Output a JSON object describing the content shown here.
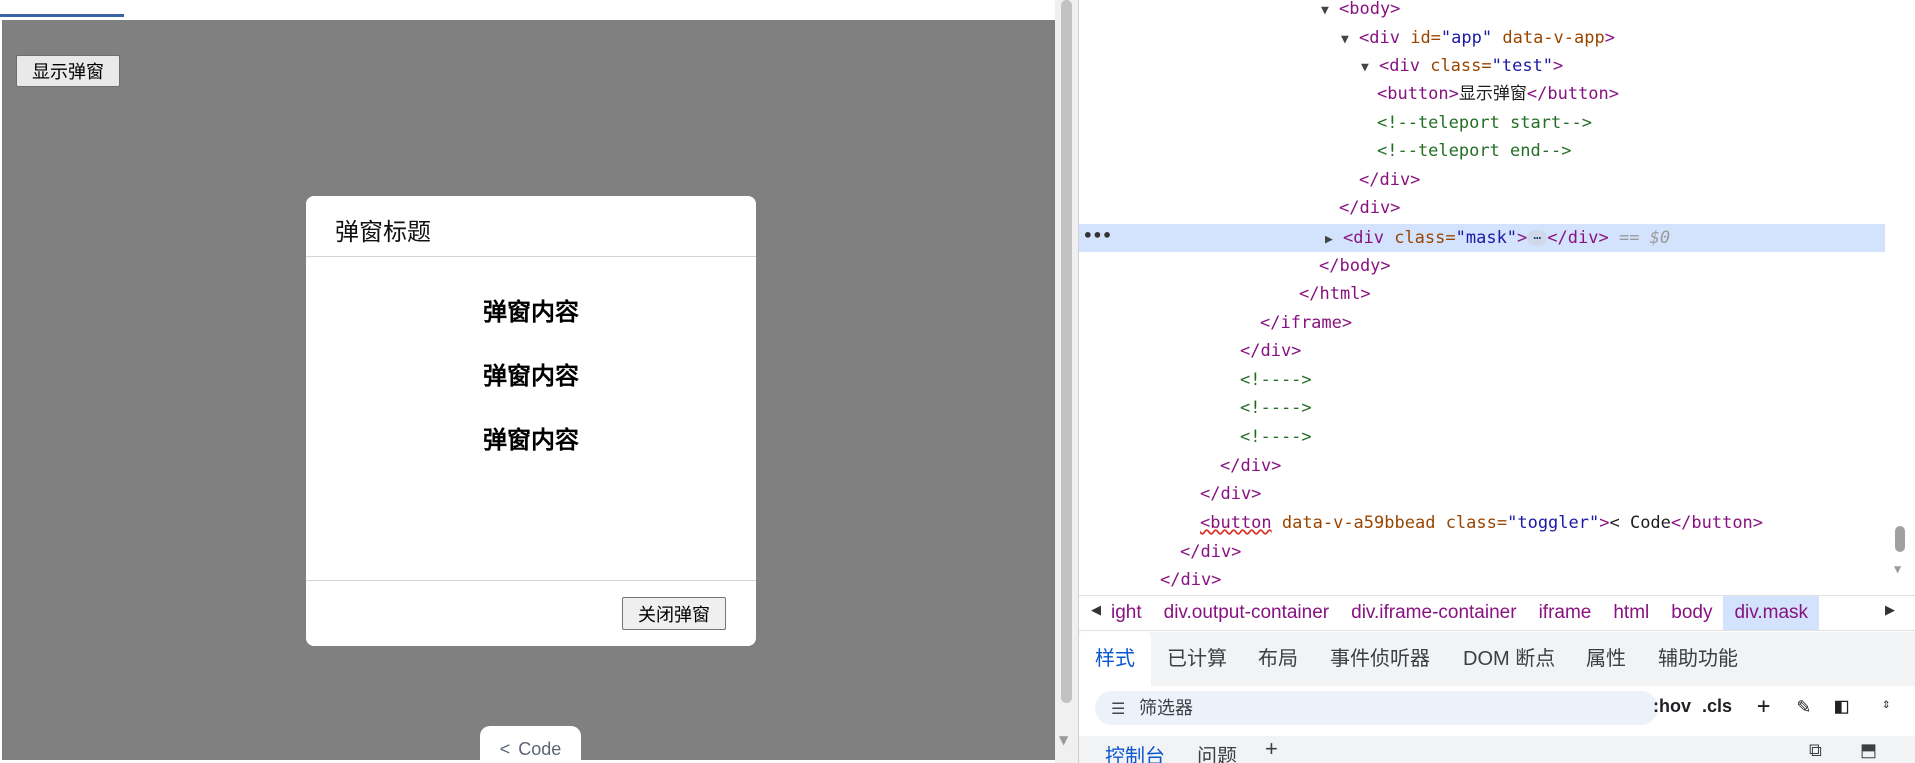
{
  "preview": {
    "show_button_label": "显示弹窗",
    "dialog": {
      "title": "弹窗标题",
      "paragraphs": [
        "弹窗内容",
        "弹窗内容",
        "弹窗内容"
      ],
      "close_button_label": "关闭弹窗"
    },
    "code_toggle": {
      "chevron": "<",
      "label": "Code"
    },
    "colors": {
      "mask": "#808080",
      "dialog": "#ffffff"
    }
  },
  "devtools": {
    "dom": {
      "body_open": "<body>",
      "app_div": {
        "tag": "<div",
        "id_attr": "id=",
        "id_val": "\"app\"",
        "data_attr": "data-v-app",
        "close": ">"
      },
      "test_div": {
        "tag": "<div",
        "class_attr": "class=",
        "class_val": "\"test\"",
        "close": ">"
      },
      "button_line": {
        "open": "<button>",
        "text": "显示弹窗",
        "close": "</button>"
      },
      "teleport_start": "<!--teleport start-->",
      "teleport_end": "<!--teleport end-->",
      "div_close_1": "</div>",
      "div_close_2": "</div>",
      "mask_div": {
        "tag": "<div",
        "class_attr": "class=",
        "class_val": "\"mask\"",
        "gt": ">",
        "ellipsis": "…",
        "close": "</div>",
        "ref": "== $0"
      },
      "body_close": "</body>",
      "html_close": "</html>",
      "iframe_close": "</iframe>",
      "div_close_3": "</div>",
      "comment_1": "<!---->",
      "comment_2": "<!---->",
      "comment_3": "<!---->",
      "div_close_4": "</div>",
      "div_close_5": "</div>",
      "toggler_button": {
        "open": "<button",
        "attr1": "data-v-a59bbead",
        "class_attr": "class=",
        "class_val": "\"toggler\"",
        "gt": ">",
        "text": "< Code",
        "close": "</button>"
      },
      "div_close_6": "</div>",
      "div_close_7": "</div>"
    },
    "breadcrumbs": [
      "ight",
      "div.output-container",
      "div.iframe-container",
      "iframe",
      "html",
      "body",
      "div.mask"
    ],
    "tabs": [
      "样式",
      "已计算",
      "布局",
      "事件侦听器",
      "DOM 断点",
      "属性",
      "辅助功能"
    ],
    "filter": {
      "placeholder": "筛选器",
      "hov": ":hov",
      "cls": ".cls"
    },
    "drawer_tabs": [
      "控制台",
      "问题"
    ],
    "colors": {
      "selected_row": "#d3e3fd",
      "active_tab": "#0b57d0"
    }
  }
}
